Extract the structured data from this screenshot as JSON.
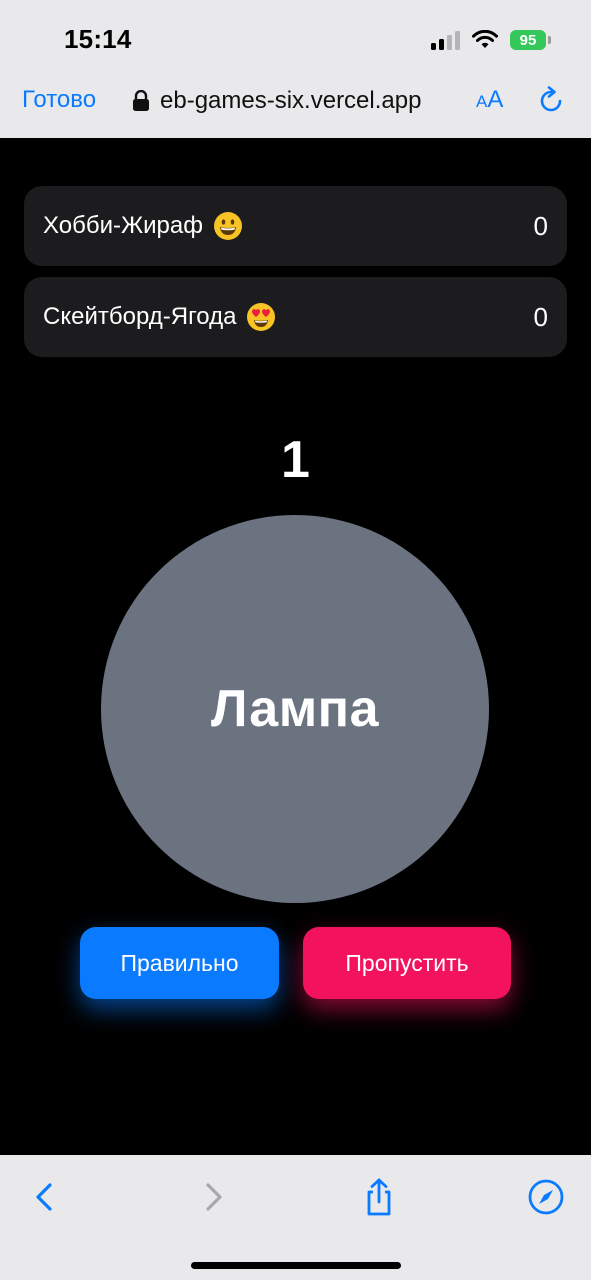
{
  "status_bar": {
    "time": "15:14",
    "battery": "95"
  },
  "browser": {
    "done_label": "Готово",
    "url": "eb-games-six.vercel.app",
    "aa_small": "A",
    "aa_large": "A"
  },
  "players": [
    {
      "name": "Хобби-Жираф",
      "emoji": "grinning-face-emoji",
      "score": "0"
    },
    {
      "name": "Скейтборд-Ягода",
      "emoji": "heart-eyes-emoji",
      "score": "0"
    }
  ],
  "game": {
    "round": "1",
    "word": "Лампа",
    "correct_label": "Правильно",
    "skip_label": "Пропустить"
  },
  "colors": {
    "accent_blue": "#0a7aff",
    "skip_pink": "#f2125e",
    "circle_gray": "#6c7380",
    "card_bg": "#1c1c1e"
  }
}
